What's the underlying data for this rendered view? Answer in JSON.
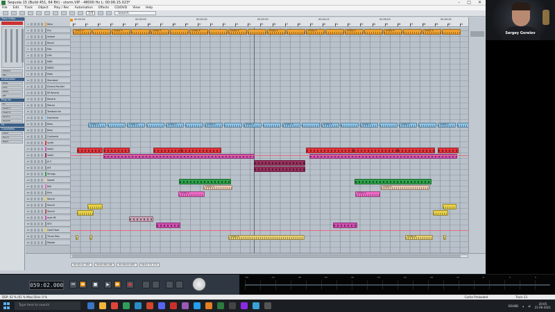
{
  "window": {
    "title": "Sequoia 15 (Build 451, 64 Bit) - storm.VIP - 48000 Hz L: 00:06:15.023*",
    "controls": [
      "–",
      "□",
      "✕"
    ]
  },
  "menu": [
    "File",
    "Edit",
    "Track",
    "Object",
    "Play / Rec",
    "Automation",
    "Effects",
    "CD/DVD",
    "View",
    "Help"
  ],
  "toolbar": {
    "zoom_value": "1/4",
    "search_placeholder": "Search"
  },
  "webcam": {
    "name": "Sergey Gorelov"
  },
  "left_panel": {
    "sections": [
      "Track Editor",
      "Automation",
      "Plug-ins",
      "FX",
      "Crossfades"
    ],
    "rows": [
      "Volume",
      "Pan",
      "Mute",
      "Solo",
      "Mode",
      "Off",
      "Fx",
      "Insert 1",
      "Insert 2",
      "Send A",
      "Send B",
      "Latch",
      "Touch",
      "Read"
    ]
  },
  "tracks": [
    {
      "num": "1",
      "name": "Keys",
      "color": "#f0a330"
    },
    {
      "num": "2",
      "name": "Dry",
      "color": "#8a8f95"
    },
    {
      "num": "3",
      "name": "Insane",
      "color": "#8a8f95"
    },
    {
      "num": "4",
      "name": "Keys2",
      "color": "#8a8f95"
    },
    {
      "num": "5",
      "name": "Pad",
      "color": "#8a8f95"
    },
    {
      "num": "6",
      "name": "LOK",
      "color": "#8a8f95"
    },
    {
      "num": "7",
      "name": "MIDI",
      "color": "#8a8f95"
    },
    {
      "num": "8",
      "name": "MIDI2",
      "color": "#8a8f95"
    },
    {
      "num": "9",
      "name": "Pads",
      "color": "#8a8f95"
    },
    {
      "num": "10",
      "name": "Standard",
      "color": "#8a8f95"
    },
    {
      "num": "11",
      "name": "Drums Parallel",
      "color": "#8a8f95"
    },
    {
      "num": "12",
      "name": "fill Reverb",
      "color": "#8a8f95"
    },
    {
      "num": "13",
      "name": "Reverb",
      "color": "#8a8f95"
    },
    {
      "num": "14",
      "name": "Return",
      "color": "#8a8f95"
    },
    {
      "num": "15",
      "name": "Tambourine",
      "color": "#8a8f95"
    },
    {
      "num": "16",
      "name": "Euphonia",
      "color": "#8fc6ea"
    },
    {
      "num": "17",
      "name": "Bass",
      "color": "#8a8f95"
    },
    {
      "num": "18",
      "name": "Bass",
      "color": "#8a8f95"
    },
    {
      "num": "19",
      "name": "Cuphonia",
      "color": "#8a8f95"
    },
    {
      "num": "20",
      "name": "synth",
      "color": "#e6353d"
    },
    {
      "num": "21",
      "name": "lead1",
      "color": "#d24fb3"
    },
    {
      "num": "22",
      "name": "lead2",
      "color": "#9a2f5c"
    },
    {
      "num": "23",
      "name": "pl 2",
      "color": "#8a8f95"
    },
    {
      "num": "24",
      "name": "pl3",
      "color": "#8a8f95"
    },
    {
      "num": "25",
      "name": "Strings",
      "color": "#2ea14a"
    },
    {
      "num": "26",
      "name": "Sweet",
      "color": "#e9c9b2"
    },
    {
      "num": "27",
      "name": "Bell",
      "color": "#ee6bc6"
    },
    {
      "num": "28",
      "name": "Kick",
      "color": "#8a8f95"
    },
    {
      "num": "29",
      "name": "Sound",
      "color": "#e7d04a"
    },
    {
      "num": "30",
      "name": "Sound",
      "color": "#8a8f95"
    },
    {
      "num": "31",
      "name": "Sound",
      "color": "#b8524f"
    },
    {
      "num": "32",
      "name": "arps fill",
      "color": "#d24fb3"
    },
    {
      "num": "33",
      "name": "SFX",
      "color": "#8a8f95"
    },
    {
      "num": "34",
      "name": "Gold Flare",
      "color": "#e7d04a"
    },
    {
      "num": "35",
      "name": "Three Men",
      "color": "#8a8f95"
    },
    {
      "num": "36",
      "name": "Master",
      "color": "#8a8f95"
    }
  ],
  "ruler": {
    "bars": [
      "10",
      "11",
      "12",
      "13",
      "14",
      "15",
      "16",
      "17",
      "18",
      "19",
      "20",
      "21",
      "22",
      "23",
      "24",
      "25",
      "26",
      "27",
      "28",
      "29",
      "30",
      "31",
      "32",
      "33",
      "34",
      "35",
      "36",
      "37",
      "38",
      "39",
      "40",
      "41"
    ],
    "times": [
      "00:00:30",
      "00:02:00",
      "00:02:45",
      "00:03:30",
      "00:04:15",
      "00:05:00",
      "00:05:45"
    ]
  },
  "clip_label": "empty 5",
  "position": {
    "cursor": "00:02:41.330",
    "start": "00:00:00.000",
    "length": "00:00:00.000",
    "end": "00:01:31.115"
  },
  "transport": {
    "counter": "059:02.000",
    "buttons": [
      "⏮",
      "⏪",
      "■",
      "▶",
      "⏩",
      "●"
    ]
  },
  "meter": {
    "labels": [
      "-60",
      "-54",
      "-48",
      "-42",
      "-36",
      "-30",
      "-24",
      "-18",
      "-12",
      "-6",
      "-3",
      "0"
    ]
  },
  "status": {
    "left": "DSP: 42 % (61 % Max)   Disk: 0 %",
    "mid": "Cache Preloaded",
    "right": "Track 23"
  },
  "taskbar": {
    "search_placeholder": "Type here to search",
    "tray_label": "SOUND",
    "time": "20:05",
    "date": "21-06-2021"
  }
}
